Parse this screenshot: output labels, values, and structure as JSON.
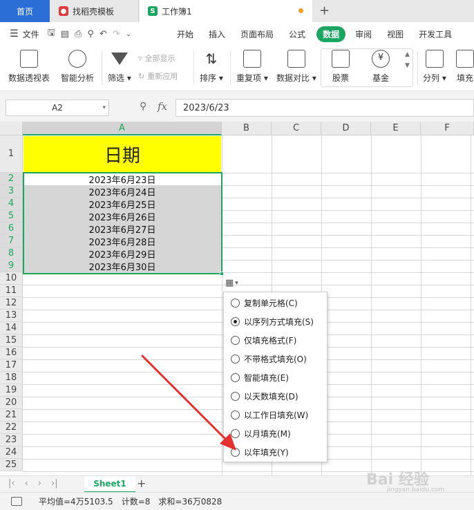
{
  "tabs": {
    "home": "首页",
    "daoke": "找稻壳模板",
    "workbook": "工作簿1",
    "add": "+"
  },
  "menu": {
    "file": "文件",
    "items": [
      "开始",
      "插入",
      "页面布局",
      "公式",
      "数据",
      "审阅",
      "视图",
      "开发工具"
    ],
    "active": "数据"
  },
  "ribbon": {
    "pivot": "数据透视表",
    "smart": "智能分析",
    "filter": "筛选",
    "show_all": "全部显示",
    "reapply": "重新应用",
    "sort": "排序",
    "dup": "重复项",
    "compare": "数据对比",
    "stock": "股票",
    "fund": "基金",
    "split": "分列",
    "fill": "填充"
  },
  "formula_bar": {
    "name_box": "A2",
    "fx": "fx",
    "value": "2023/6/23"
  },
  "grid": {
    "columns": [
      "A",
      "B",
      "C",
      "D",
      "E",
      "F"
    ],
    "rows": [
      "1",
      "2",
      "3",
      "4",
      "5",
      "6",
      "7",
      "8",
      "9",
      "10",
      "11",
      "12",
      "13",
      "14",
      "15",
      "16",
      "17",
      "18",
      "19",
      "20",
      "21",
      "22",
      "23",
      "24",
      "25"
    ],
    "title": "日期",
    "dates": [
      "2023年6月23日",
      "2023年6月24日",
      "2023年6月25日",
      "2023年6月26日",
      "2023年6月27日",
      "2023年6月28日",
      "2023年6月29日",
      "2023年6月30日"
    ]
  },
  "autofill_menu": {
    "options": [
      "复制单元格(C)",
      "以序列方式填充(S)",
      "仅填充格式(F)",
      "不带格式填充(O)",
      "智能填充(E)",
      "以天数填充(D)",
      "以工作日填充(W)",
      "以月填充(M)",
      "以年填充(Y)"
    ],
    "selected": "以序列方式填充(S)"
  },
  "sheets": {
    "active": "Sheet1",
    "add": "+"
  },
  "status": {
    "average": "平均值=4万5103.5",
    "count": "计数=8",
    "sum": "求和=36万0828"
  },
  "watermark": {
    "brand": "Bai 经验",
    "url": "jingyan.baidu.com"
  },
  "colors": {
    "accent_green": "#1aa662",
    "home_tab_blue": "#2b6fd6",
    "title_fill": "#ffff00",
    "arrow_red": "#e53030"
  }
}
